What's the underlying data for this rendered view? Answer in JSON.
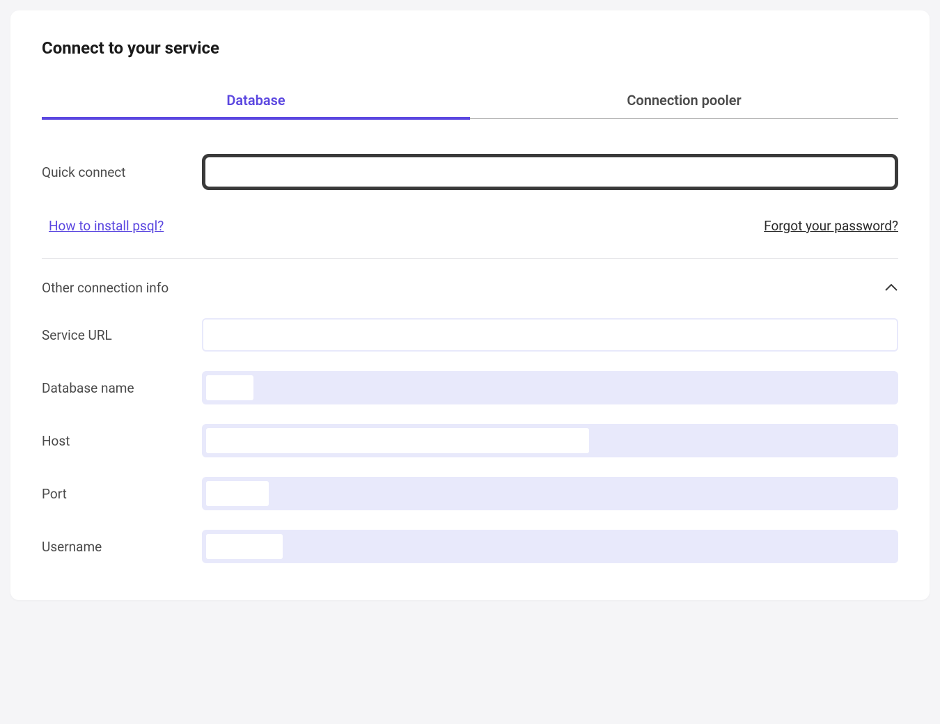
{
  "title": "Connect to your service",
  "tabs": {
    "database": "Database",
    "pooler": "Connection pooler"
  },
  "quickConnect": {
    "label": "Quick connect",
    "value": ""
  },
  "links": {
    "installPsql": "How to install psql?",
    "forgotPassword": "Forgot your password?"
  },
  "otherInfo": {
    "title": "Other connection info",
    "fields": {
      "serviceUrl": {
        "label": "Service URL",
        "value": ""
      },
      "databaseName": {
        "label": "Database name",
        "value": ""
      },
      "host": {
        "label": "Host",
        "value": ""
      },
      "port": {
        "label": "Port",
        "value": ""
      },
      "username": {
        "label": "Username",
        "value": ""
      }
    }
  }
}
